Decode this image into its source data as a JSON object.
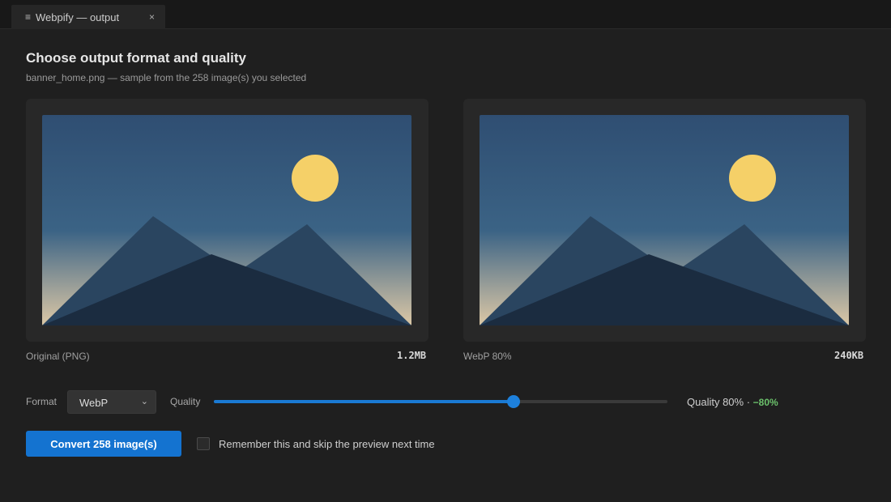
{
  "tab": {
    "title": "Webpify — output",
    "menu_icon": "hamburger-menu-icon",
    "close_icon": "close-icon",
    "close_glyph": "×",
    "menu_glyph": "≡"
  },
  "header": {
    "title": "Choose output format and quality",
    "subtitle": "banner_home.png — sample from the 258 image(s) you selected"
  },
  "previews": {
    "original": {
      "label": "Original (PNG)",
      "size": "1.2MB"
    },
    "converted": {
      "label": "WebP 80%",
      "size": "240KB"
    }
  },
  "controls": {
    "format_label": "Format",
    "format_value": "WebP",
    "chevron_glyph": "⌄",
    "quality_label": "Quality",
    "quality_value": 0.8,
    "quality_readout": "Quality 80% ·",
    "reduction": "−80%"
  },
  "actions": {
    "convert_label": "Convert 258 image(s)",
    "remember_label": "Remember this and skip the preview next time",
    "remember_checked": false
  },
  "colors": {
    "accent": "#1473d0",
    "success": "#6cc26c",
    "sun": "#f5d068",
    "sky_top": "#2f4f73",
    "sky_horizon": "#dcc8a6"
  }
}
